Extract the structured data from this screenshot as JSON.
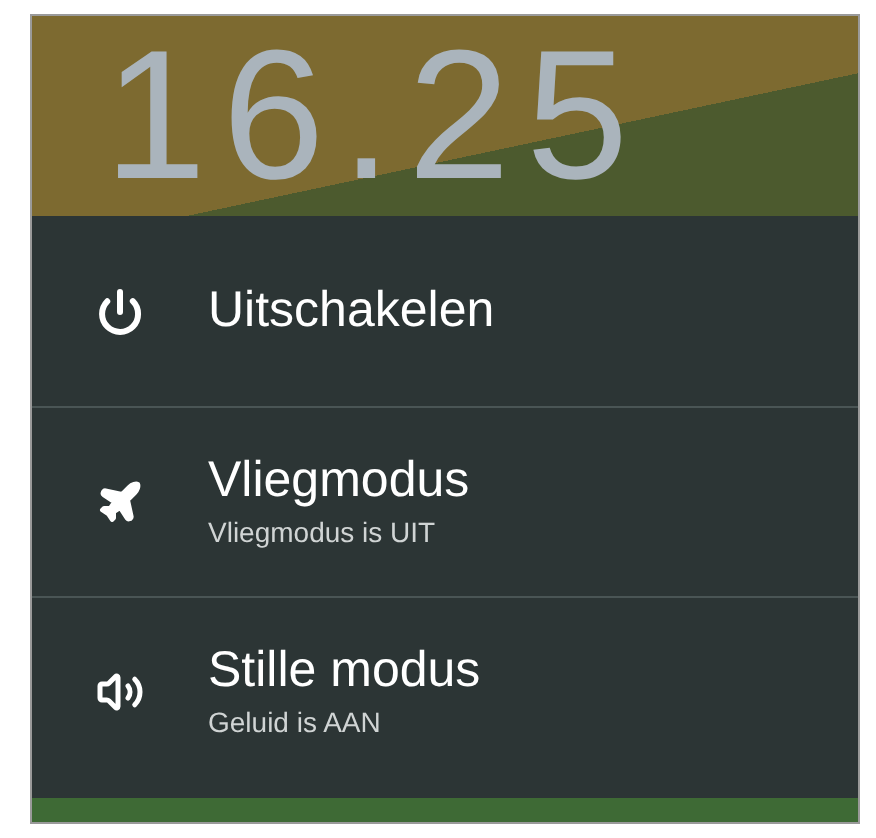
{
  "clock": "16.25",
  "menu": [
    {
      "kind": "power",
      "title": "Uitschakelen"
    },
    {
      "kind": "airplane",
      "title": "Vliegmodus",
      "subtitle": "Vliegmodus is UIT"
    },
    {
      "kind": "sound",
      "title": "Stille modus",
      "subtitle": "Geluid is AAN"
    }
  ]
}
